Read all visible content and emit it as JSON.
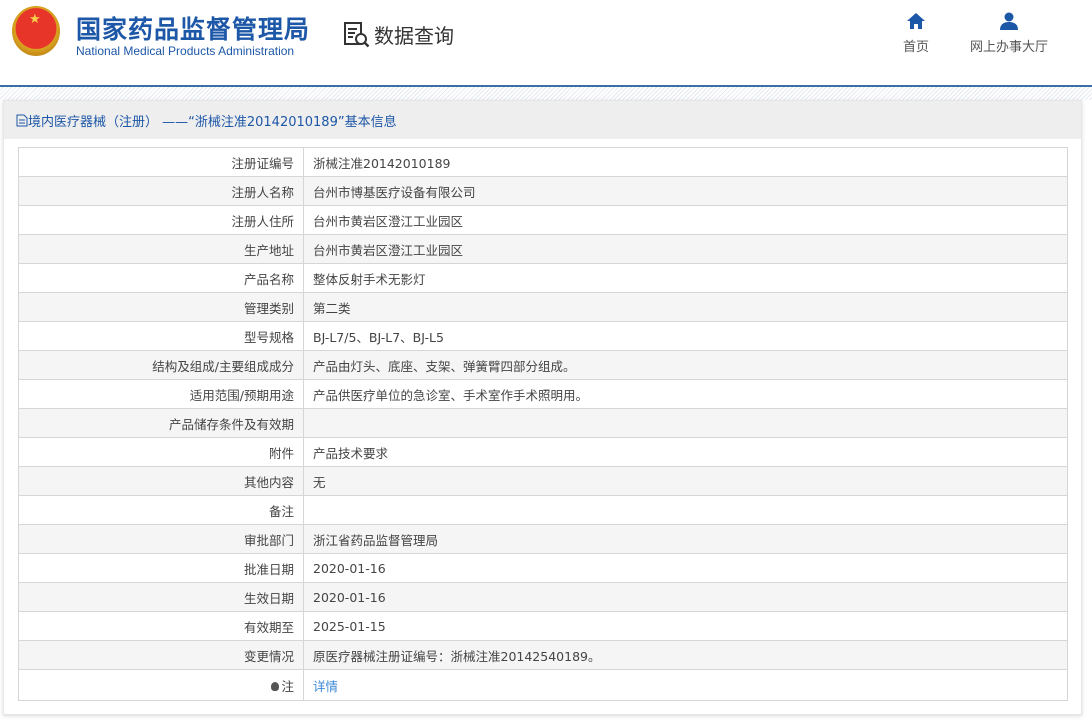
{
  "header": {
    "org_cn": "国家药品监督管理局",
    "org_en": "National Medical Products Administration",
    "section": "数据查询",
    "nav": [
      {
        "label": "首页",
        "icon": "home-icon"
      },
      {
        "label": "网上办事大厅",
        "icon": "user-icon"
      }
    ]
  },
  "panel": {
    "title": "境内医疗器械（注册） ——“浙械注准20142010189”基本信息"
  },
  "rows": [
    {
      "label": "注册证编号",
      "value": "浙械注准20142010189"
    },
    {
      "label": "注册人名称",
      "value": "台州市博基医疗设备有限公司"
    },
    {
      "label": "注册人住所",
      "value": "台州市黄岩区澄江工业园区"
    },
    {
      "label": "生产地址",
      "value": "台州市黄岩区澄江工业园区"
    },
    {
      "label": "产品名称",
      "value": "整体反射手术无影灯"
    },
    {
      "label": "管理类别",
      "value": "第二类"
    },
    {
      "label": "型号规格",
      "value": "BJ-L7/5、BJ-L7、BJ-L5"
    },
    {
      "label": "结构及组成/主要组成成分",
      "value": "产品由灯头、底座、支架、弹簧臂四部分组成。"
    },
    {
      "label": "适用范围/预期用途",
      "value": "产品供医疗单位的急诊室、手术室作手术照明用。"
    },
    {
      "label": "产品储存条件及有效期",
      "value": ""
    },
    {
      "label": "附件",
      "value": "产品技术要求"
    },
    {
      "label": "其他内容",
      "value": "无"
    },
    {
      "label": "备注",
      "value": ""
    },
    {
      "label": "审批部门",
      "value": "浙江省药品监督管理局"
    },
    {
      "label": "批准日期",
      "value": "2020-01-16"
    },
    {
      "label": "生效日期",
      "value": "2020-01-16"
    },
    {
      "label": "有效期至",
      "value": "2025-01-15"
    },
    {
      "label": "变更情况",
      "value": "原医疗器械注册证编号：浙械注准20142540189。"
    }
  ],
  "note": {
    "label": "注",
    "link": "详情"
  }
}
